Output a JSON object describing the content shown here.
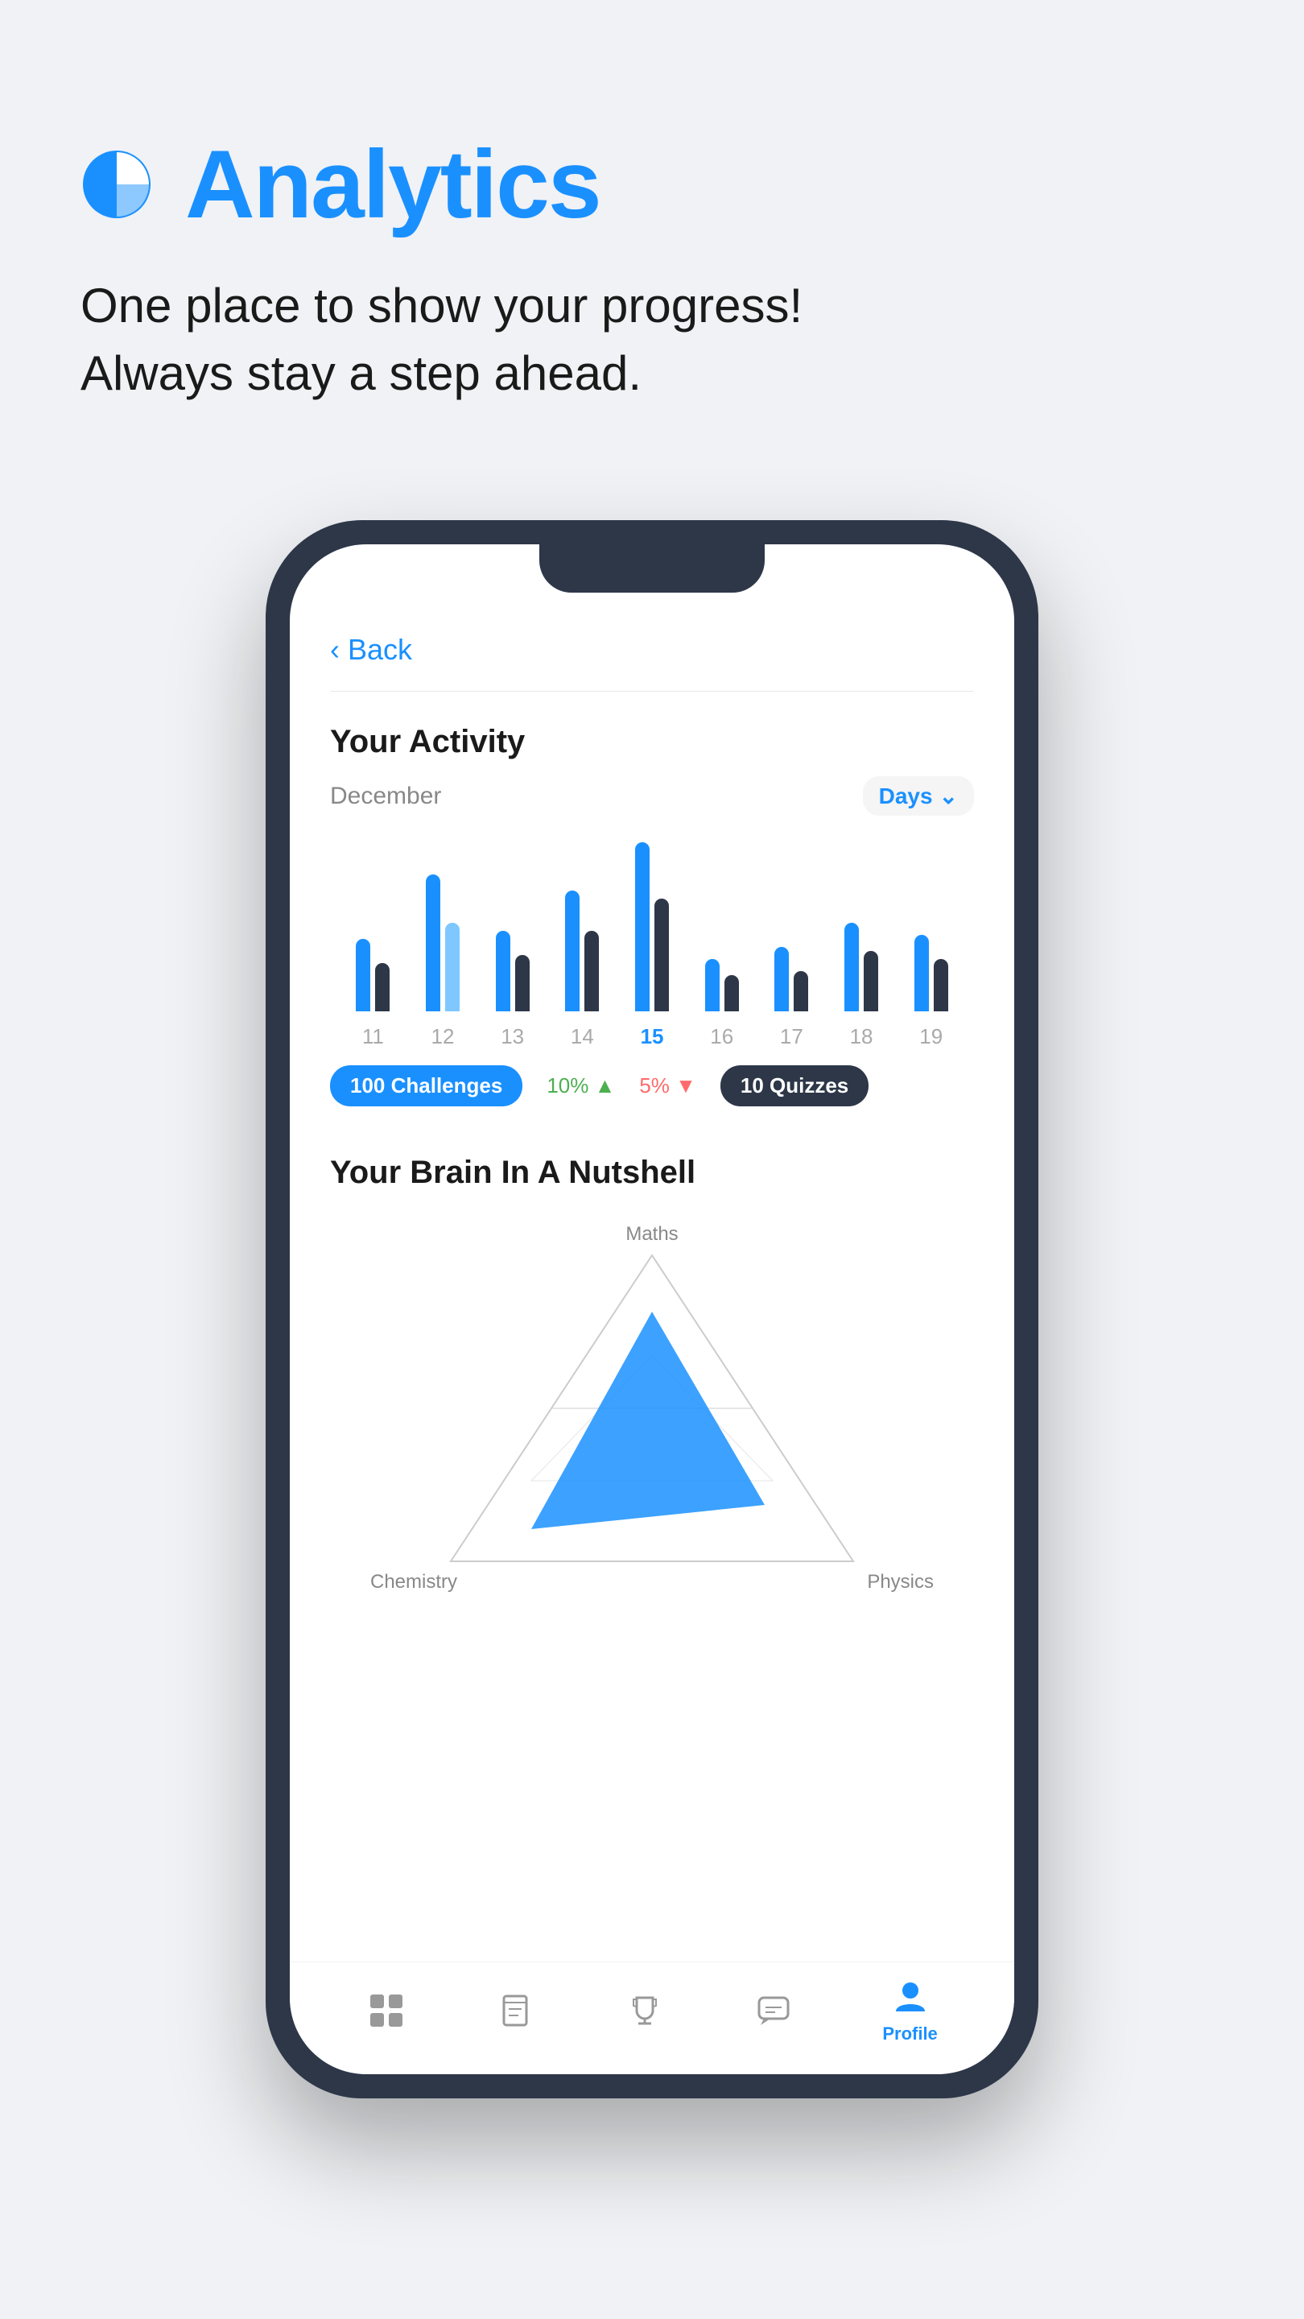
{
  "header": {
    "title": "Analytics",
    "subtitle_line1": "One place to show your progress!",
    "subtitle_line2": "Always stay a step ahead."
  },
  "phone": {
    "back_label": "Back",
    "activity": {
      "title": "Your Activity",
      "month": "December",
      "period": "Days",
      "bars": [
        {
          "day": "11",
          "heights": [
            90,
            60
          ],
          "active": false
        },
        {
          "day": "12",
          "heights": [
            170,
            110
          ],
          "active": false
        },
        {
          "day": "13",
          "heights": [
            100,
            70
          ],
          "active": false
        },
        {
          "day": "14",
          "heights": [
            150,
            100
          ],
          "active": false
        },
        {
          "day": "15",
          "heights": [
            200,
            140
          ],
          "active": true
        },
        {
          "day": "16",
          "heights": [
            70,
            50
          ],
          "active": false
        },
        {
          "day": "17",
          "heights": [
            80,
            55
          ],
          "active": false
        },
        {
          "day": "18",
          "heights": [
            110,
            80
          ],
          "active": false
        },
        {
          "day": "19",
          "heights": [
            100,
            70
          ],
          "active": false
        }
      ],
      "stats": [
        {
          "label": "100 Challenges",
          "type": "badge-blue"
        },
        {
          "label": "10%",
          "change": "up"
        },
        {
          "label": "5%",
          "change": "down"
        },
        {
          "label": "10 Quizzes",
          "type": "badge-dark"
        }
      ]
    },
    "brain": {
      "title": "Your Brain In A Nutshell",
      "labels": {
        "top": "Maths",
        "bottom_left": "Chemistry",
        "bottom_right": "Physics"
      }
    },
    "nav": [
      {
        "icon": "grid-icon",
        "label": "",
        "active": false
      },
      {
        "icon": "book-icon",
        "label": "",
        "active": false
      },
      {
        "icon": "trophy-icon",
        "label": "",
        "active": false
      },
      {
        "icon": "chat-icon",
        "label": "",
        "active": false
      },
      {
        "icon": "profile-icon",
        "label": "Profile",
        "active": true
      }
    ]
  },
  "colors": {
    "accent": "#1a90ff",
    "dark": "#2d3748",
    "text_primary": "#1a1a1a",
    "text_secondary": "#888888",
    "background": "#f0f2f5"
  }
}
